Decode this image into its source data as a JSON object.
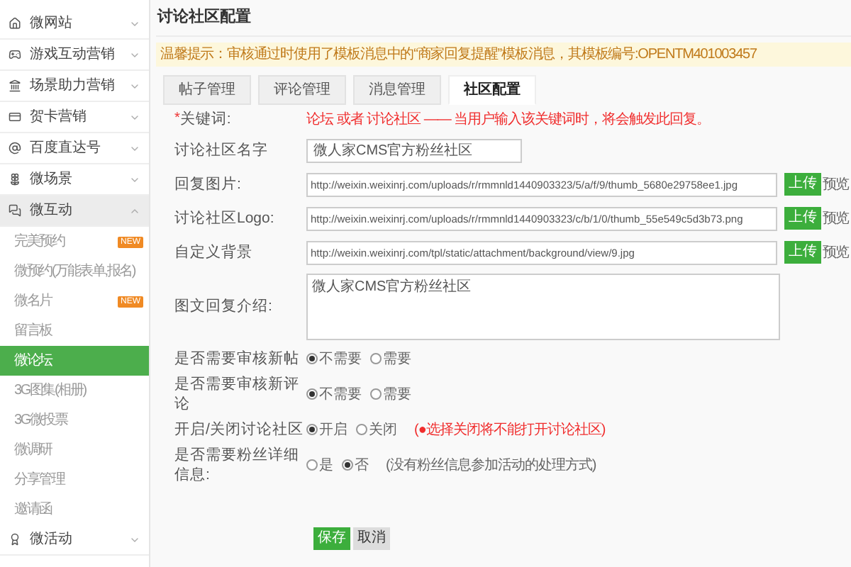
{
  "sidebar": {
    "items": [
      {
        "label": "微网站",
        "expanded": false
      },
      {
        "label": "游戏互动营销",
        "expanded": false
      },
      {
        "label": "场景助力营销",
        "expanded": false
      },
      {
        "label": "贺卡营销",
        "expanded": false
      },
      {
        "label": "百度直达号",
        "expanded": false
      },
      {
        "label": "微场景",
        "expanded": false
      },
      {
        "label": "微互动",
        "expanded": true,
        "children": [
          {
            "label": "完美预约",
            "badge": "NEW",
            "selected": false
          },
          {
            "label": "微预约(万能表单,报名)",
            "selected": false
          },
          {
            "label": "微名片",
            "badge": "NEW",
            "selected": false
          },
          {
            "label": "留言板",
            "selected": false
          },
          {
            "label": "微论坛",
            "selected": true
          },
          {
            "label": "3G图集(相册)",
            "selected": false
          },
          {
            "label": "3G微投票",
            "selected": false
          },
          {
            "label": "微调研",
            "selected": false
          },
          {
            "label": "分享管理",
            "selected": false
          },
          {
            "label": "邀请函",
            "selected": false
          }
        ]
      },
      {
        "label": "微活动",
        "expanded": false
      }
    ]
  },
  "page_title": "讨论社区配置",
  "notice": "温馨提示：审核通过时使用了模板消息中的“商家回复提醒”模板消息，其模板编号:OPENTM401003457",
  "tabs": [
    {
      "label": "帖子管理",
      "selected": false
    },
    {
      "label": "评论管理",
      "selected": false
    },
    {
      "label": "消息管理",
      "selected": false
    },
    {
      "label": "社区配置",
      "selected": true
    }
  ],
  "form": [
    {
      "kind": "keyword",
      "label": "关键词:",
      "required_mark": "*",
      "hint": "论坛 或者 讨论社区 —— 当用户输入该关键词时，将会触发此回复。"
    },
    {
      "kind": "text",
      "label": "讨论社区名字",
      "value": "微人家CMS官方粉丝社区"
    },
    {
      "kind": "upload",
      "label": "回复图片:",
      "value": "http://weixin.weixinrj.com/uploads/r/rmmnld1440903323/5/a/f/9/thumb_5680e29758ee1.jpg",
      "button": "上传",
      "link": "预览"
    },
    {
      "kind": "upload",
      "label": "讨论社区Logo:",
      "value": "http://weixin.weixinrj.com/uploads/r/rmmnld1440903323/c/b/1/0/thumb_55e549c5d3b73.png",
      "button": "上传",
      "link": "预览"
    },
    {
      "kind": "upload",
      "label": "自定义背景",
      "value": "http://weixin.weixinrj.com/tpl/static/attachment/background/view/9.jpg",
      "button": "上传",
      "link": "预览"
    },
    {
      "kind": "textarea",
      "label": "图文回复介绍:",
      "value": "微人家CMS官方粉丝社区"
    },
    {
      "kind": "radio",
      "label": "是否需要审核新帖",
      "options": [
        {
          "label": "不需要",
          "selected": true
        },
        {
          "label": "需要",
          "selected": false
        }
      ]
    },
    {
      "kind": "radio",
      "label": "是否需要审核新评论",
      "options": [
        {
          "label": "不需要",
          "selected": true
        },
        {
          "label": "需要",
          "selected": false
        }
      ]
    },
    {
      "kind": "radio",
      "label": "开启/关闭讨论社区",
      "options": [
        {
          "label": "开启",
          "selected": true
        },
        {
          "label": "关闭",
          "selected": false
        }
      ],
      "note": {
        "text": "(●选择关闭将不能打开讨论社区)",
        "warning": true
      }
    },
    {
      "kind": "radio",
      "label": "是否需要粉丝详细信息:",
      "options": [
        {
          "label": "是",
          "selected": false
        },
        {
          "label": "否",
          "selected": true
        }
      ],
      "note": {
        "text": "(没有粉丝信息参加活动的处理方式)",
        "warning": false
      }
    }
  ],
  "actions": [
    {
      "label": "保存",
      "kind": "primary"
    },
    {
      "label": "取消",
      "kind": "secondary"
    }
  ]
}
